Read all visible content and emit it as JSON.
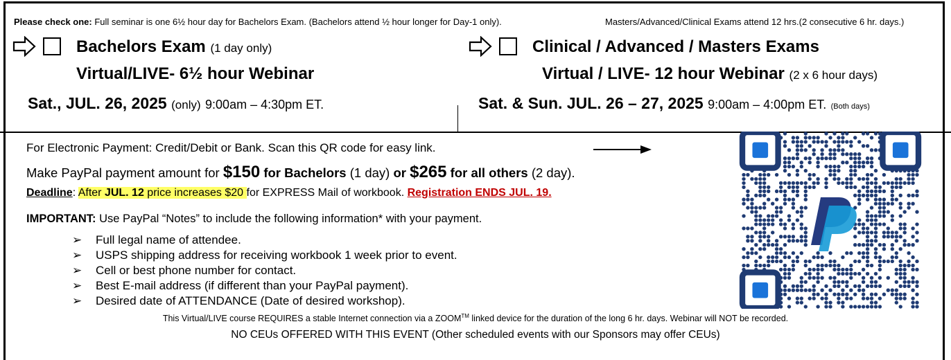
{
  "header": {
    "check_label": "Please check one:",
    "check_text": " Full seminar is one 6½ hour day for Bachelors Exam. (Bachelors attend ½ hour longer for Day-1 only).",
    "masters_text": "Masters/Advanced/Clinical Exams attend 12 hrs.(2 consecutive 6 hr. days.)"
  },
  "bachelors": {
    "title": "Bachelors Exam",
    "title_note": "(1 day only)",
    "webinar": "Virtual/LIVE- 6½ hour Webinar",
    "date": "Sat., JUL. 26, 2025",
    "date_note": "(only)",
    "time": "9:00am – 4:30pm ET."
  },
  "clinical": {
    "title": "Clinical / Advanced / Masters Exams",
    "webinar": "Virtual / LIVE- 12 hour Webinar",
    "webinar_note": "(2 x 6 hour days)",
    "date": "Sat. & Sun. JUL. 26 – 27, 2025",
    "time": "9:00am – 4:00pm ET.",
    "time_note": "(Both days)"
  },
  "payment": {
    "electronic": "For Electronic Payment: Credit/Debit or Bank.  Scan this QR code for easy link.",
    "paypal_pre": "Make PayPal payment amount for ",
    "bach_amount": "$150",
    "bach_label": " for Bachelors",
    "bach_days": " (1 day) ",
    "or": "or ",
    "others_amount": "$265",
    "others_label": " for all others",
    "others_days": " (2 day)."
  },
  "deadline": {
    "label": "Deadline",
    "colon": ": ",
    "after": "After ",
    "date": "JUL. 12",
    "increase": " price increases $20 ",
    "rest": "for EXPRESS Mail of workbook. ",
    "reg_end": "Registration ENDS JUL. 19."
  },
  "important": {
    "label": "IMPORTANT:",
    "text": " Use PayPal “Notes” to include the following information* with your payment.",
    "items": [
      "Full legal name of attendee.",
      "USPS shipping address for receiving workbook 1 week prior to event.",
      "Cell or best phone number for contact.",
      "Best E-mail address (if different than your PayPal payment).",
      "Desired date of ATTENDANCE (Date of desired workshop)."
    ]
  },
  "footer": {
    "line1_a": "This Virtual/LIVE course REQUIRES a stable Internet connection via a ZOOM",
    "line1_tm": "TM",
    "line1_b": " linked device for the duration of the long 6 hr. days. Webinar will NOT be recorded.",
    "line2": "NO CEUs OFFERED WITH THIS EVENT (Other scheduled events with our Sponsors may offer CEUs)"
  },
  "colors": {
    "highlight": "#ffff66",
    "red": "#c00000",
    "qr_blue": "#1f3b73",
    "paypal_dark": "#253b80",
    "paypal_light": "#179bd7"
  },
  "icons": {
    "arrow": "hollow-right-arrow",
    "qr": "qr-code-paypal"
  }
}
